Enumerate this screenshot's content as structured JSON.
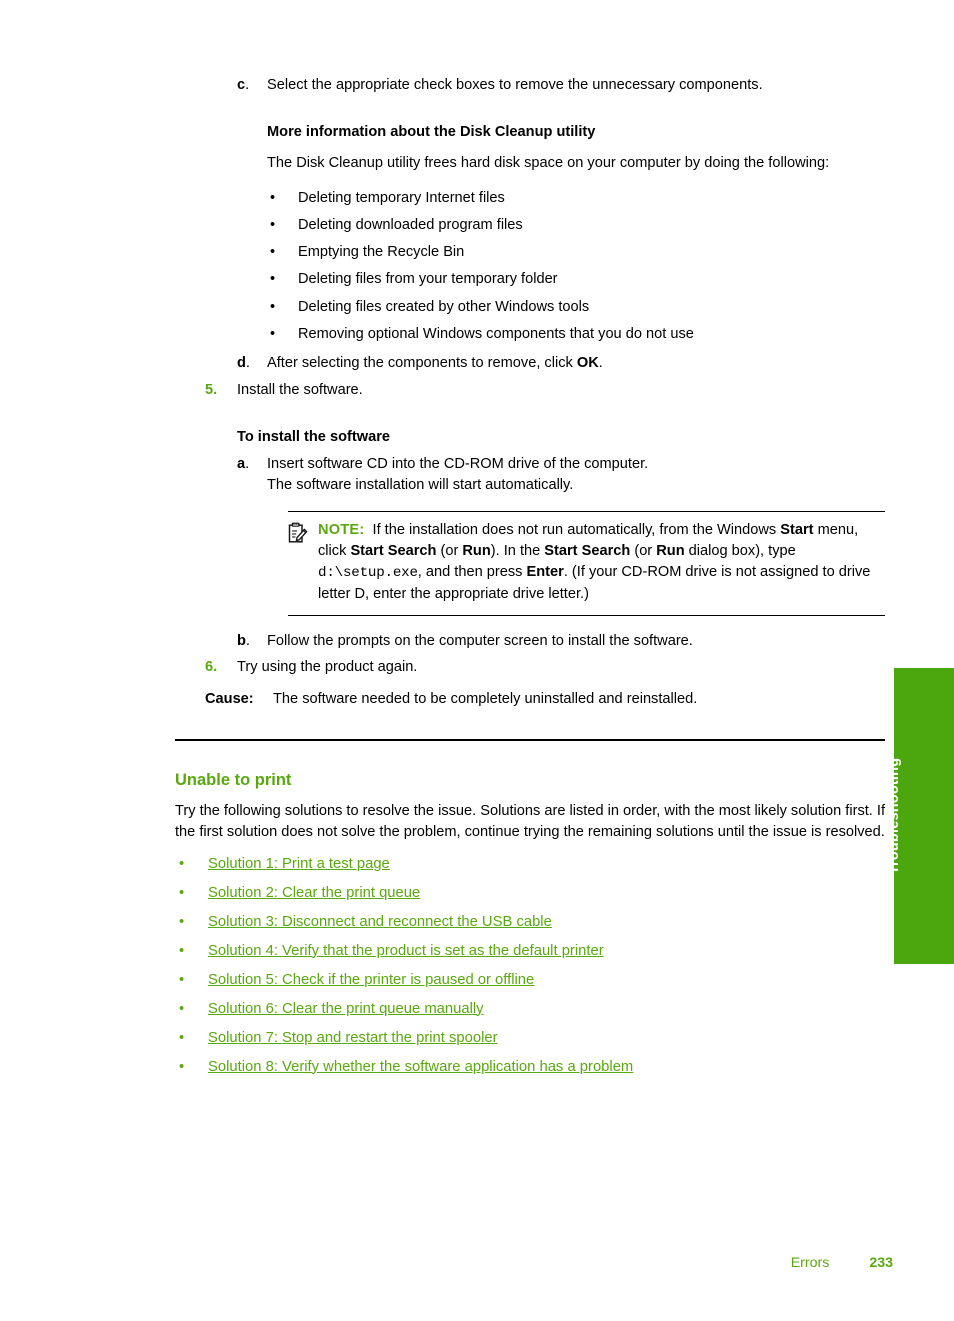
{
  "step_c": {
    "marker": "c",
    "text": "Select the appropriate check boxes to remove the unnecessary components."
  },
  "disk_cleanup": {
    "heading": "More information about the Disk Cleanup utility",
    "intro": "The Disk Cleanup utility frees hard disk space on your computer by doing the following:",
    "bullet_glyph": "•",
    "items": [
      "Deleting temporary Internet files",
      "Deleting downloaded program files",
      "Emptying the Recycle Bin",
      "Deleting files from your temporary folder",
      "Deleting files created by other Windows tools",
      "Removing optional Windows components that you do not use"
    ]
  },
  "step_d": {
    "marker": "d",
    "text_before": "After selecting the components to remove, click ",
    "bold": "OK",
    "text_after": "."
  },
  "step_5": {
    "marker": "5.",
    "text": "Install the software."
  },
  "install_section": {
    "heading": "To install the software",
    "step_a": {
      "marker": "a",
      "line1": "Insert software CD into the CD-ROM drive of the computer.",
      "line2": "The software installation will start automatically."
    },
    "note": {
      "icon": "note-pencil-icon",
      "label": "NOTE:",
      "p1": "If the installation does not run automatically, from the Windows ",
      "b1": "Start",
      "p2": " menu, click ",
      "b2": "Start Search",
      "p3": " (or ",
      "b3": "Run",
      "p4": "). In the ",
      "b4": "Start Search",
      "p5": " (or ",
      "b5": "Run",
      "p6": " dialog box), type ",
      "code": "d:\\setup.exe",
      "p7": ", and then press ",
      "b6": "Enter",
      "p8": ". (If your CD-ROM drive is not assigned to drive letter D, enter the appropriate drive letter.)"
    },
    "step_b": {
      "marker": "b",
      "text": "Follow the prompts on the computer screen to install the software."
    }
  },
  "step_6": {
    "marker": "6.",
    "text": "Try using the product again."
  },
  "cause": {
    "label": "Cause:",
    "text": "The software needed to be completely uninstalled and reinstalled."
  },
  "unable_to_print": {
    "title": "Unable to print",
    "paragraph": "Try the following solutions to resolve the issue. Solutions are listed in order, with the most likely solution first. If the first solution does not solve the problem, continue trying the remaining solutions until the issue is resolved.",
    "bullet_glyph": "•",
    "links": [
      "Solution 1: Print a test page",
      "Solution 2: Clear the print queue",
      "Solution 3: Disconnect and reconnect the USB cable",
      "Solution 4: Verify that the product is set as the default printer",
      "Solution 5: Check if the printer is paused or offline",
      "Solution 6: Clear the print queue manually",
      "Solution 7: Stop and restart the print spooler",
      "Solution 8: Verify whether the software application has a problem"
    ]
  },
  "side_tab": {
    "label": "Troubleshooting"
  },
  "footer": {
    "section": "Errors",
    "page": "233"
  },
  "colors": {
    "accent_green": "#5aa80f",
    "tab_green": "#4ba70d",
    "text_black": "#000000"
  }
}
